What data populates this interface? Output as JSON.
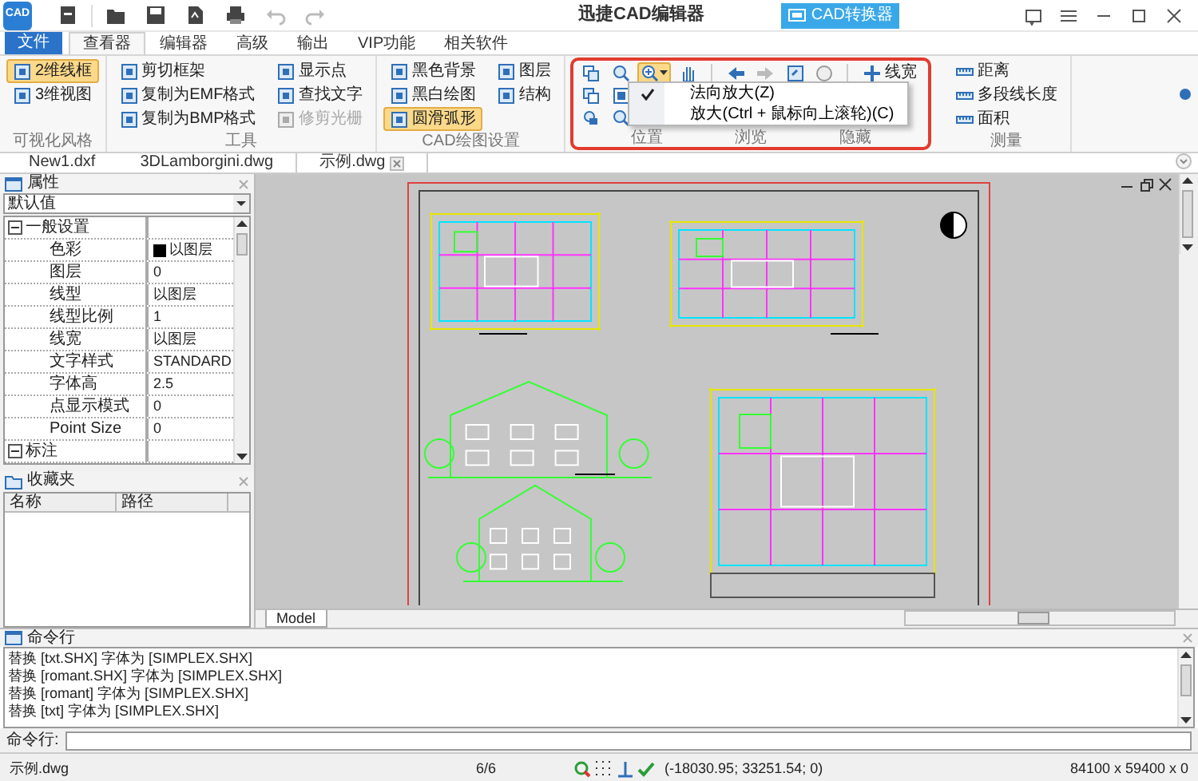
{
  "app": {
    "logo_text": "CAD",
    "title": "迅捷CAD编辑器",
    "converter_button": "CAD转换器"
  },
  "file_button": "文件",
  "tabs": [
    {
      "label": "查看器",
      "selected": true
    },
    {
      "label": "编辑器",
      "selected": false
    },
    {
      "label": "高级",
      "selected": false
    },
    {
      "label": "输出",
      "selected": false
    },
    {
      "label": "VIP功能",
      "selected": false
    },
    {
      "label": "相关软件",
      "selected": false
    }
  ],
  "ribbon_groups": [
    {
      "label": "可视化风格",
      "columns": [
        [
          {
            "label": "2维线框",
            "selected": true,
            "disabled": false
          },
          {
            "label": "3维视图",
            "selected": false,
            "disabled": false
          }
        ]
      ]
    },
    {
      "label": "工具",
      "columns": [
        [
          {
            "label": "剪切框架",
            "selected": false,
            "disabled": false
          },
          {
            "label": "复制为EMF格式",
            "selected": false,
            "disabled": false
          },
          {
            "label": "复制为BMP格式",
            "selected": false,
            "disabled": false
          }
        ],
        [
          {
            "label": "显示点",
            "selected": false,
            "disabled": false
          },
          {
            "label": "查找文字",
            "selected": false,
            "disabled": false
          },
          {
            "label": "修剪光栅",
            "selected": false,
            "disabled": true
          }
        ]
      ]
    },
    {
      "label": "CAD绘图设置",
      "columns": [
        [
          {
            "label": "黑色背景",
            "selected": false,
            "disabled": false
          },
          {
            "label": "黑白绘图",
            "selected": false,
            "disabled": false
          },
          {
            "label": "圆滑弧形",
            "selected": true,
            "disabled": false
          }
        ],
        [
          {
            "label": "图层",
            "selected": false,
            "disabled": false
          },
          {
            "label": "结构",
            "selected": false,
            "disabled": false
          }
        ]
      ]
    }
  ],
  "navigation": {
    "group_labels": [
      "位置",
      "浏览",
      "隐藏"
    ],
    "linewidth_button": "线宽",
    "zoom_menu": [
      {
        "label": "法向放大(Z)",
        "checked": true
      },
      {
        "label": "放大(Ctrl + 鼠标向上滚轮)(C)",
        "checked": false
      }
    ]
  },
  "measure_group": {
    "label": "测量",
    "items": [
      "距离",
      "多段线长度",
      "面积"
    ]
  },
  "doc_tabs": [
    {
      "label": "New1.dxf",
      "selected": false
    },
    {
      "label": "3DLamborgini.dwg",
      "selected": false
    },
    {
      "label": "示例.dwg",
      "selected": true
    }
  ],
  "properties": {
    "title": "属性",
    "dropdown": "默认值",
    "sections": [
      {
        "title": "一般设置",
        "expanded": true,
        "rows": [
          {
            "name": "色彩",
            "value": "以图层",
            "color": "#000000"
          },
          {
            "name": "图层",
            "value": "0"
          },
          {
            "name": "线型",
            "value": "以图层"
          },
          {
            "name": "线型比例",
            "value": "1"
          },
          {
            "name": "线宽",
            "value": "以图层"
          },
          {
            "name": "文字样式",
            "value": "STANDARD"
          },
          {
            "name": "字体高",
            "value": "2.5"
          },
          {
            "name": "点显示模式",
            "value": "0"
          },
          {
            "name": "Point Size",
            "value": "0"
          }
        ]
      },
      {
        "title": "标注",
        "expanded": true
      }
    ]
  },
  "favorites": {
    "title": "收藏夹",
    "columns": [
      "名称",
      "路径"
    ]
  },
  "model_tab": "Model",
  "command": {
    "title": "命令行",
    "log": [
      "替换 [txt.SHX] 字体为 [SIMPLEX.SHX]",
      "替换 [romant.SHX] 字体为 [SIMPLEX.SHX]",
      "替换 [romant] 字体为 [SIMPLEX.SHX]",
      "替换 [txt] 字体为 [SIMPLEX.SHX]"
    ],
    "prompt": "命令行:"
  },
  "status_bar": {
    "file": "示例.dwg",
    "page": "6/6",
    "coords": "(-18030.95; 33251.54; 0)",
    "size": "84100 x 59400 x 0"
  }
}
